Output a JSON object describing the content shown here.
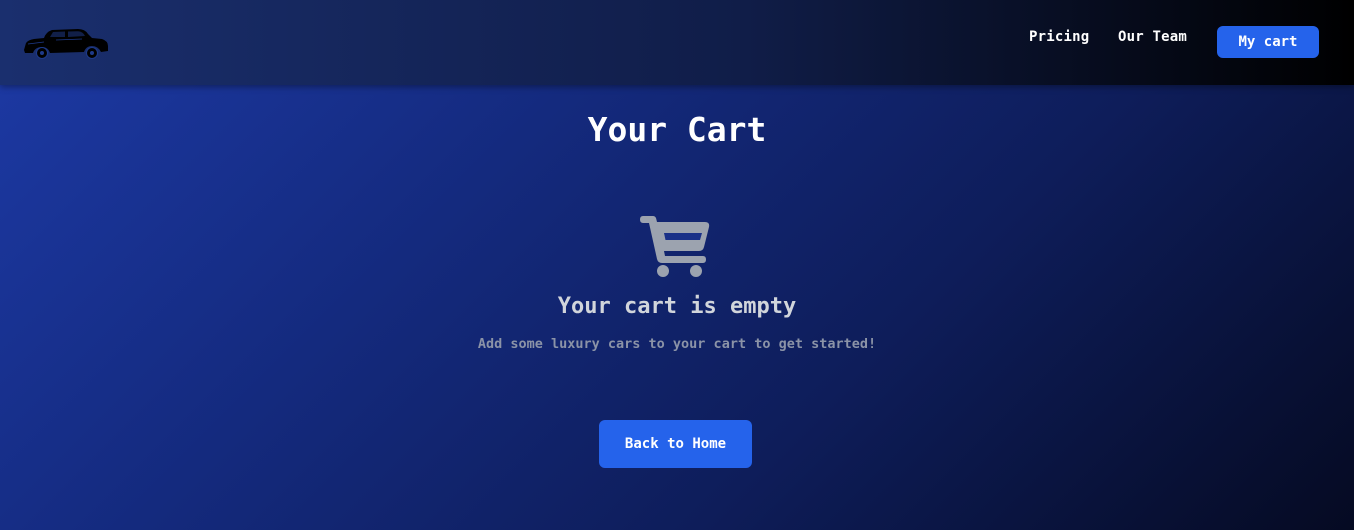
{
  "nav": {
    "logo_icon": "vintage-car-icon",
    "links": [
      {
        "label": "Pricing"
      },
      {
        "label": "Our Team"
      }
    ],
    "cart_button_label": "My cart"
  },
  "main": {
    "title": "Your Cart",
    "cart_icon": "shopping-cart-icon",
    "empty_heading": "Your cart is empty",
    "empty_subtext": "Add some luxury cars to your cart to get started!",
    "back_button_label": "Back to Home"
  },
  "colors": {
    "accent": "#2563eb",
    "cart_icon": "#9ca3af",
    "heading_muted": "#d1d5db",
    "subtext_muted": "#8b93a7"
  }
}
